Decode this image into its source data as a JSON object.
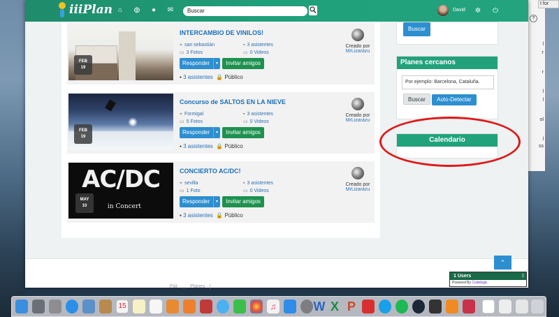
{
  "app": {
    "name": "iiiPlan"
  },
  "header": {
    "search_placeholder": "Buscar",
    "user_name": "David"
  },
  "events": [
    {
      "title": "INTERCAMBIO DE VINILOS!",
      "month": "FEB",
      "day": "19",
      "location": "san sebastián",
      "attendees": "3 asistentes",
      "photos": "3 Fotos",
      "videos": "0 Videos",
      "respond_label": "Responder",
      "invite_label": "Invitar amigos",
      "attendees_footer": "3 asistentes",
      "privacy": "Público",
      "created_by_label": "Creado por",
      "creator": "MrLizarazu"
    },
    {
      "title": "Concurso de SALTOS EN LA NIEVE",
      "month": "FEB",
      "day": "19",
      "location": "Formigal",
      "attendees": "3 asistentes",
      "photos": "5 Fotos",
      "videos": "0 Videos",
      "respond_label": "Responder",
      "invite_label": "Invitar amigos",
      "attendees_footer": "3 asistentes",
      "privacy": "Público",
      "created_by_label": "Creado por",
      "creator": "MrLizarazu"
    },
    {
      "title": "CONCIERTO AC/DC!",
      "month": "MAY",
      "day": "10",
      "location": "sevilla",
      "attendees": "3 asistentes",
      "photos": "1 Foto",
      "videos": "0 Videos",
      "respond_label": "Responder",
      "invite_label": "Invitar amigos",
      "attendees_footer": "3 asistentes",
      "privacy": "Público",
      "created_by_label": "Creado por",
      "creator": "MrLizarazu",
      "poster_text": "AC/DC",
      "poster_sub": "in Concert"
    }
  ],
  "sidebar": {
    "search_button": "Buscar",
    "nearby": {
      "title": "Planes cercanos",
      "placeholder": "Por ejemplo: Barcelona, Cataluña.",
      "search_button": "Buscar",
      "detect_button": "Auto-Detectar"
    },
    "calendar": {
      "title": "Calendario"
    }
  },
  "users_widget": {
    "title": "1 Users",
    "powered_prefix": "Powered By",
    "powered_brand": "Codelogic"
  },
  "background": {
    "top_right_text": "t for"
  },
  "colors": {
    "brand_green": "#21a27b",
    "button_blue": "#2d8fd0",
    "button_green": "#1e9150",
    "link_blue": "#2d70b3",
    "highlight_red": "#e01818"
  }
}
